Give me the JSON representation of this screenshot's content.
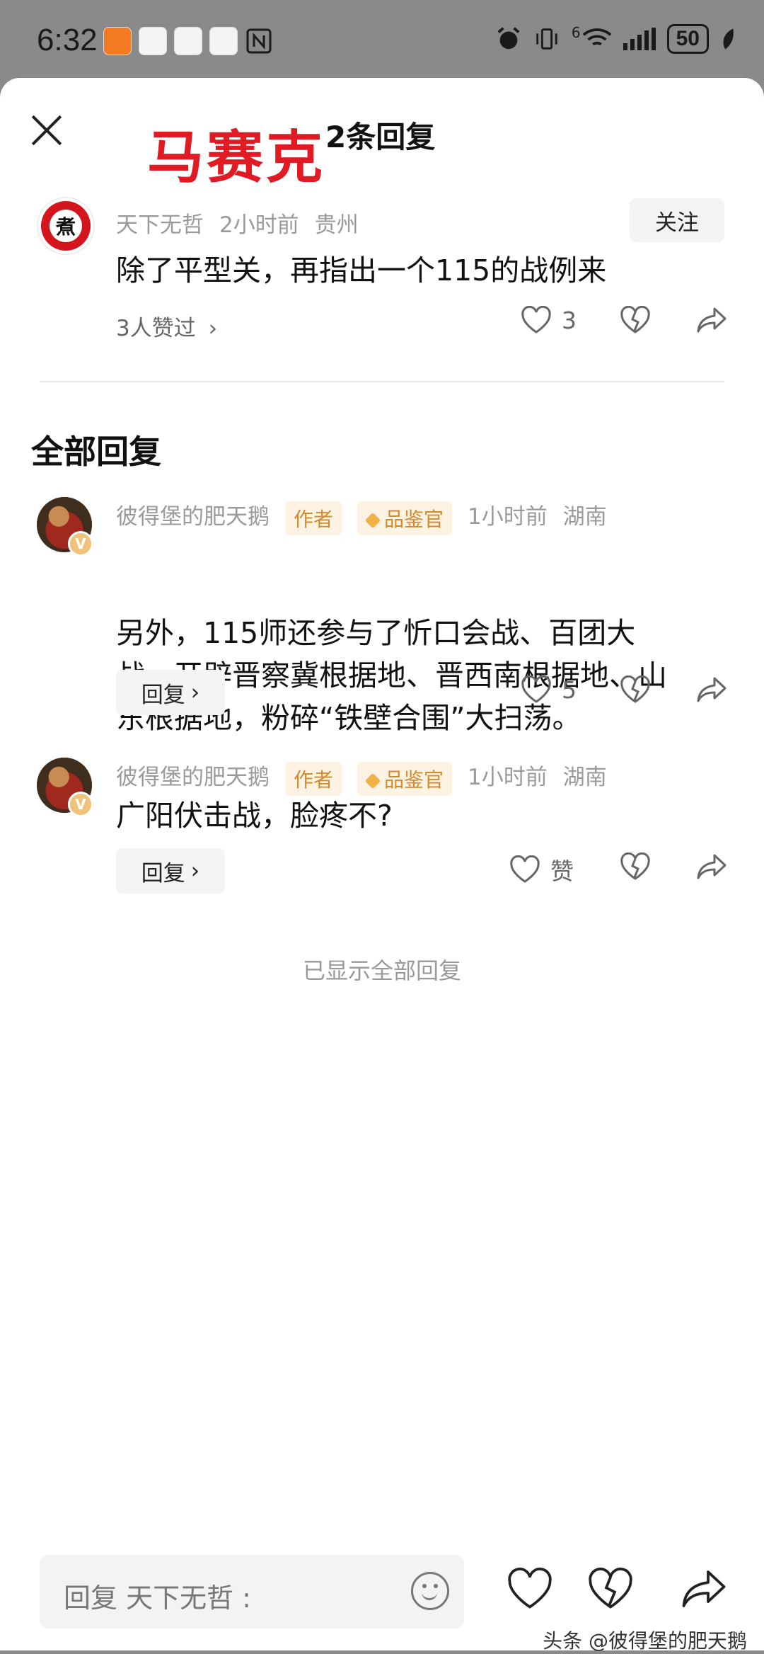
{
  "status_bar": {
    "time": "6:32",
    "battery": "50",
    "network": "6"
  },
  "sheet": {
    "title": "2条回复",
    "red_overlay": "马赛克"
  },
  "top_comment": {
    "user": "天下无哲",
    "time": "2小时前",
    "location": "贵州",
    "follow_label": "关注",
    "text": "除了平型关，再指出一个115的战例来",
    "liked_by": "3人赞过",
    "like_count": "3",
    "avatar_char": "煮"
  },
  "section_title": "全部回复",
  "replies": [
    {
      "user": "彼得堡的肥天鹅",
      "tag_author": "作者",
      "tag_judge": "品鉴官",
      "time": "1小时前",
      "location": "湖南",
      "text_line1": "另外，115师还参与了忻口会战、百团大",
      "text_line2": "战，开辟晋察冀根据地、晋西南根据地、山",
      "text_line3": "东根据地，粉碎“铁壁合围”大扫荡。",
      "reply_label": "回复",
      "like_count": "5"
    },
    {
      "user": "彼得堡的肥天鹅",
      "tag_author": "作者",
      "tag_judge": "品鉴官",
      "time": "1小时前",
      "location": "湖南",
      "text_line1": "广阳伏击战，脸疼不?",
      "reply_label": "回复",
      "like_count": "赞"
    }
  ],
  "all_shown": "已显示全部回复",
  "bottom_bar": {
    "placeholder": "回复 天下无哲 :"
  },
  "source_watermark": "头条 @彼得堡的肥天鹅"
}
